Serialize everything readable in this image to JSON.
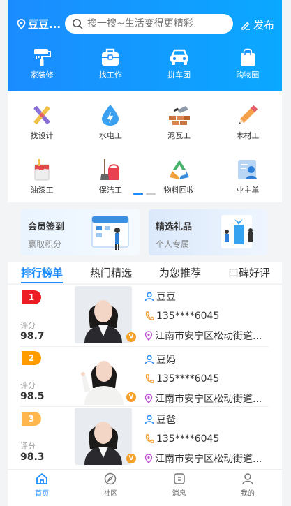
{
  "header": {
    "location": "豆豆...",
    "search_placeholder": "搜一搜~生活变得更精彩",
    "publish": "发布",
    "top_categories": [
      {
        "label": "家装修",
        "icon": "paint-roller-icon"
      },
      {
        "label": "找工作",
        "icon": "briefcase-icon"
      },
      {
        "label": "拼车团",
        "icon": "car-icon"
      },
      {
        "label": "购物圈",
        "icon": "shopping-bag-icon"
      }
    ]
  },
  "categories": [
    {
      "label": "找设计",
      "icon": "design-tools-icon"
    },
    {
      "label": "水电工",
      "icon": "water-drop-icon"
    },
    {
      "label": "泥瓦工",
      "icon": "brick-trowel-icon"
    },
    {
      "label": "木材工",
      "icon": "pencil-icon"
    },
    {
      "label": "油漆工",
      "icon": "paint-bucket-icon"
    },
    {
      "label": "保洁工",
      "icon": "broom-bucket-icon"
    },
    {
      "label": "物料回收",
      "icon": "recycle-icon"
    },
    {
      "label": "业主单",
      "icon": "owner-id-icon"
    }
  ],
  "promos": [
    {
      "title": "会员签到",
      "subtitle": "赢取积分"
    },
    {
      "title": "精选礼品",
      "subtitle": "个人专属"
    }
  ],
  "tabs": [
    "排行榜单",
    "热门精选",
    "为您推荐",
    "口碑好评"
  ],
  "active_tab": "排行榜单",
  "ranking": [
    {
      "rank": "1",
      "score_label": "评分",
      "score": "98.7",
      "name": "豆豆",
      "phone": "135****6045",
      "address": "江南市安宁区松动街道..."
    },
    {
      "rank": "2",
      "score_label": "评分",
      "score": "98.5",
      "name": "豆妈",
      "phone": "135****6045",
      "address": "江南市安宁区松动街道..."
    },
    {
      "rank": "3",
      "score_label": "评分",
      "score": "98.3",
      "name": "豆爸",
      "phone": "135****6045",
      "address": "江南市安宁区松动街道..."
    }
  ],
  "tabbar": [
    {
      "label": "首页",
      "icon": "home-icon",
      "active": true
    },
    {
      "label": "社区",
      "icon": "compass-icon",
      "active": false
    },
    {
      "label": "消息",
      "icon": "message-icon",
      "active": false
    },
    {
      "label": "我的",
      "icon": "user-icon",
      "active": false
    }
  ],
  "colors": {
    "primary": "#1b8cff",
    "rank1": "#ee1c25",
    "rank2": "#ff9d00",
    "rank3": "#ffb74d"
  }
}
